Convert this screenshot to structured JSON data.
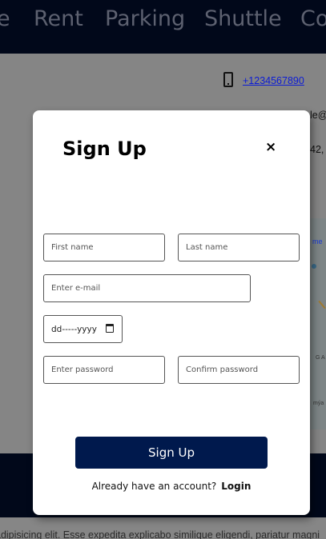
{
  "nav": {
    "items": [
      "e",
      "Rent",
      "Parking",
      "Shuttle",
      "Co"
    ]
  },
  "contact": {
    "phone": "+1234567890",
    "email_peek": "le@",
    "address_peek": "42,"
  },
  "map": {
    "link_peek": "me",
    "label_a": "G A",
    "label_b": "mýa"
  },
  "footer": {
    "lorem": "adipisicing elit. Esse expedita explicabo similique eligendi, pariatur magni"
  },
  "modal": {
    "title": "Sign Up",
    "close_label": "×",
    "first_name_placeholder": "First name",
    "last_name_placeholder": "Last name",
    "email_placeholder": "Enter e-mail",
    "date_placeholder": "dd-----yyyy",
    "password_placeholder": "Enter password",
    "confirm_password_placeholder": "Confirm password",
    "submit_label": "Sign Up",
    "account_prompt": "Already have an account?",
    "login_label": "Login"
  },
  "colors": {
    "nav_bg": "#01081a",
    "submit_bg": "#00194d",
    "link": "#0b1bd6"
  }
}
